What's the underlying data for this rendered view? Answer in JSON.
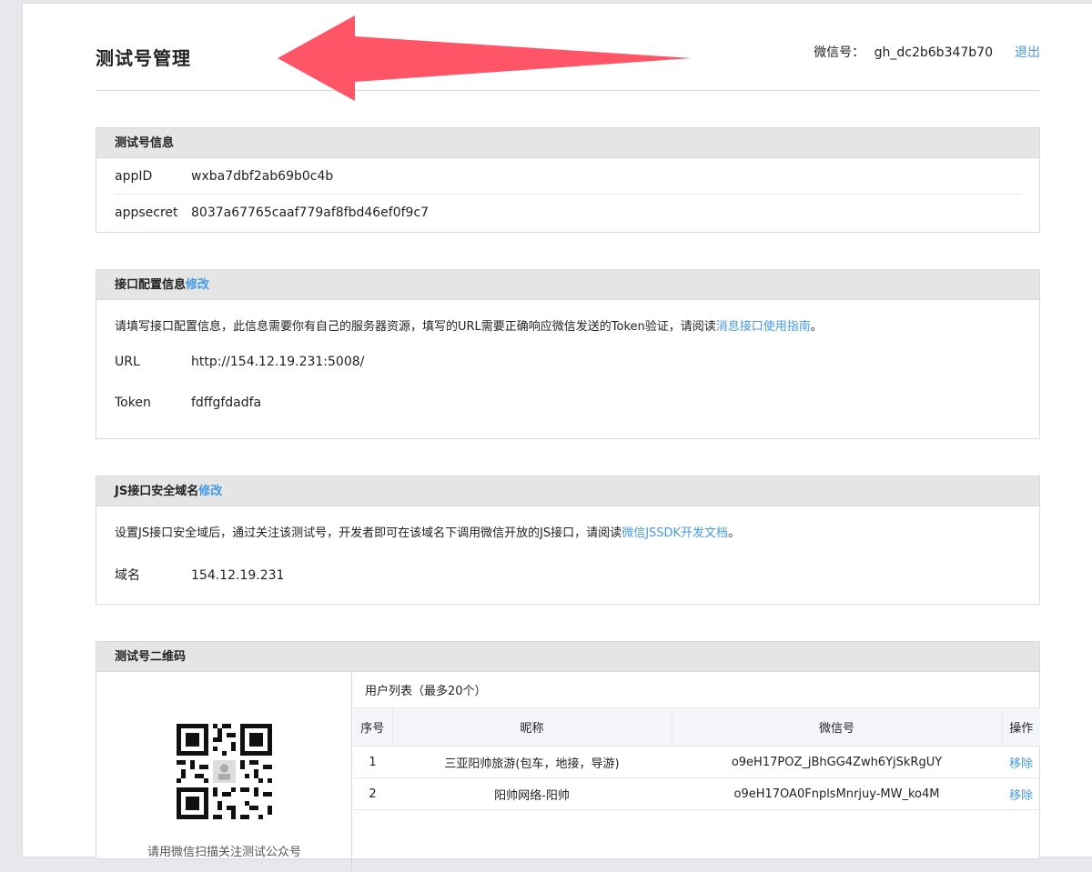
{
  "header": {
    "title": "测试号管理",
    "account_label": "微信号：",
    "account_id": "gh_dc2b6b347b70",
    "logout": "退出"
  },
  "info_panel": {
    "title": "测试号信息",
    "rows": [
      {
        "key": "appID",
        "value": "wxba7dbf2ab69b0c4b"
      },
      {
        "key": "appsecret",
        "value": "8037a67765caaf779af8fbd46ef0f9c7"
      }
    ]
  },
  "api_panel": {
    "title": "接口配置信息",
    "edit": "修改",
    "desc_prefix": "请填写接口配置信息，此信息需要你有自己的服务器资源，填写的URL需要正确响应微信发送的Token验证，请阅读",
    "desc_link": "消息接口使用指南",
    "desc_suffix": "。",
    "rows": [
      {
        "key": "URL",
        "value": "http://154.12.19.231:5008/"
      },
      {
        "key": "Token",
        "value": "fdffgfdadfa"
      }
    ]
  },
  "js_panel": {
    "title": "JS接口安全域名",
    "edit": "修改",
    "desc_prefix": "设置JS接口安全域后，通过关注该测试号，开发者即可在该域名下调用微信开放的JS接口，请阅读",
    "desc_link": "微信JSSDK开发文档",
    "desc_suffix": "。",
    "rows": [
      {
        "key": "域名",
        "value": "154.12.19.231"
      }
    ]
  },
  "qr_panel": {
    "title": "测试号二维码",
    "caption": "请用微信扫描关注测试公众号",
    "user_list_title": "用户列表（最多20个）",
    "columns": [
      "序号",
      "昵称",
      "微信号",
      "操作"
    ],
    "users": [
      {
        "index": "1",
        "nickname": "三亚阳帅旅游(包车，地接，导游)",
        "wechat_id": "o9eH17POZ_jBhGG4Zwh6YjSkRgUY",
        "action": "移除"
      },
      {
        "index": "2",
        "nickname": "阳帅网络-阳帅",
        "wechat_id": "o9eH17OA0FnplsMnrjuy-MW_ko4M",
        "action": "移除"
      }
    ]
  },
  "colors": {
    "link": "#459ae9",
    "arrow": "#ff5566",
    "panel_header": "#e5e5e5"
  }
}
